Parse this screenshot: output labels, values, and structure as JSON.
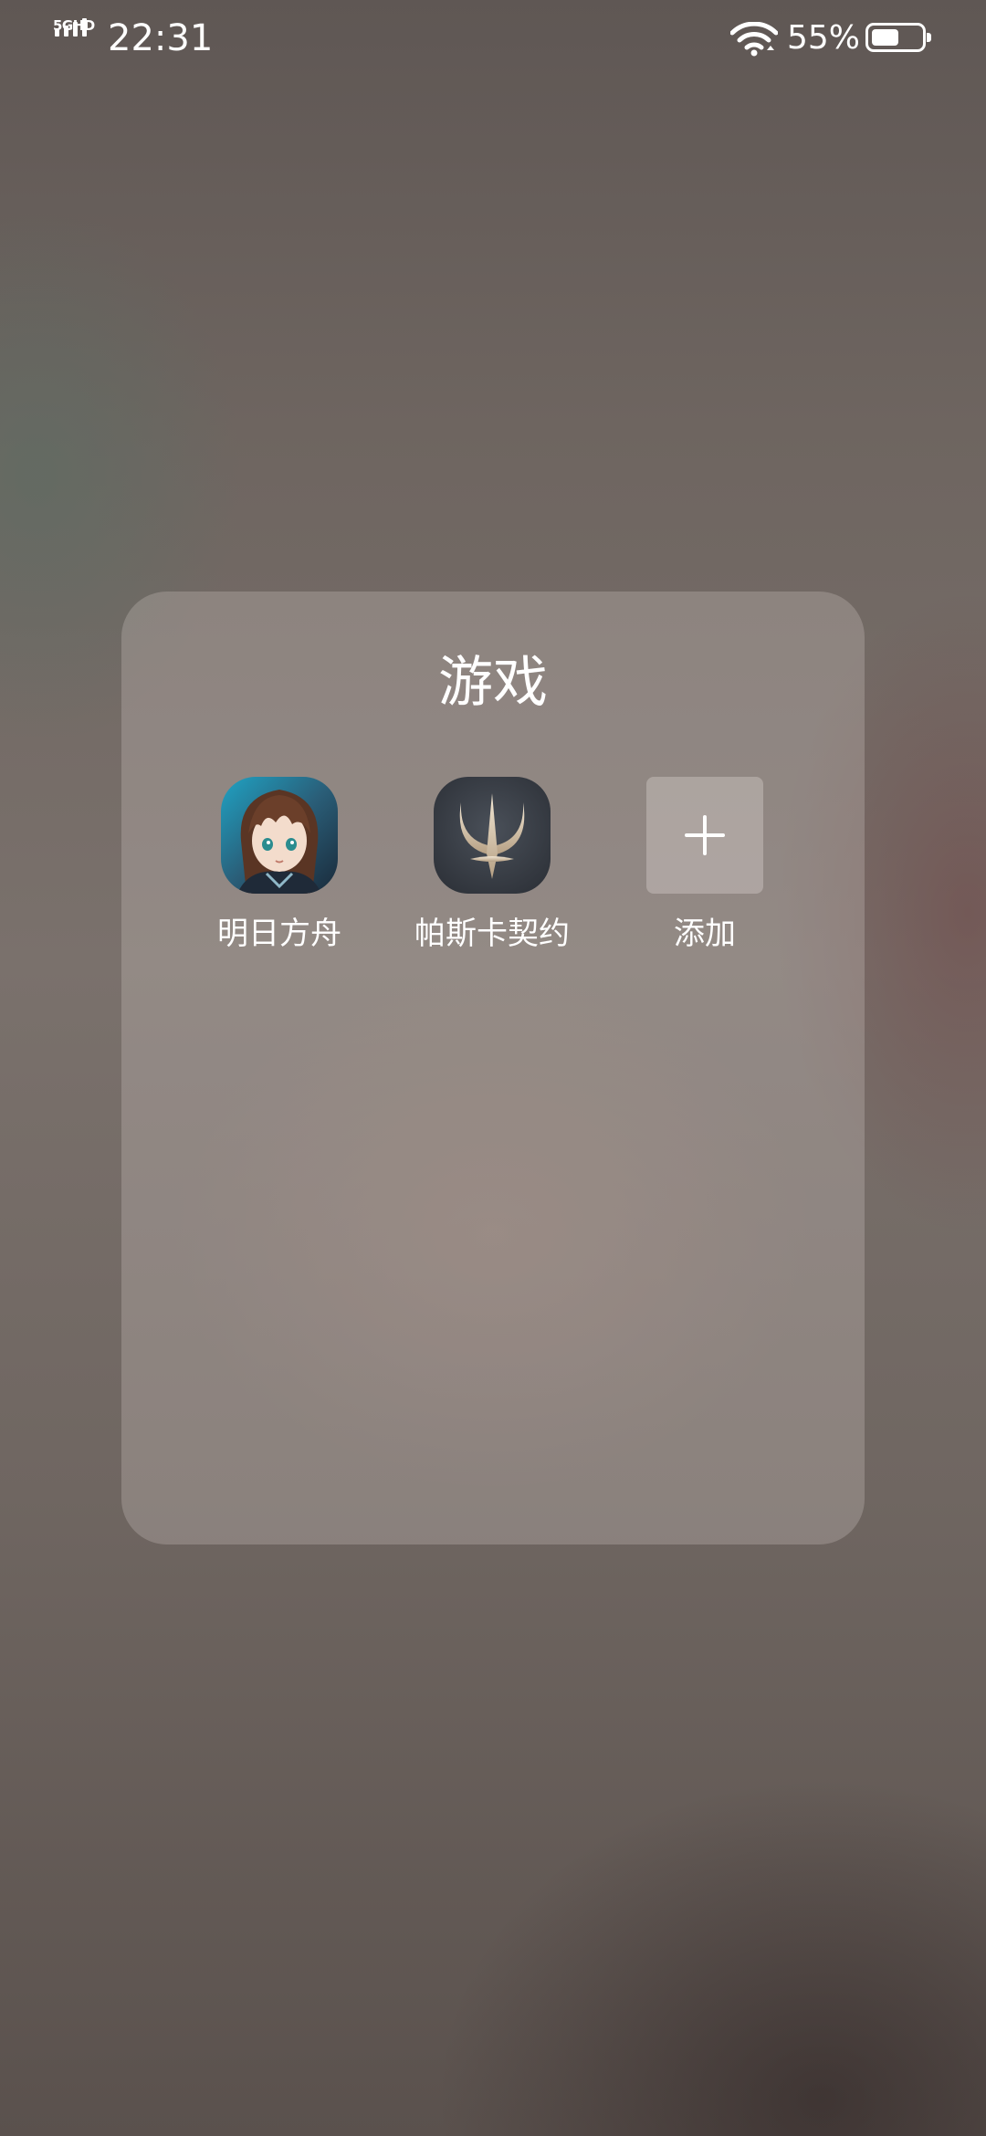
{
  "status_bar": {
    "network_type": "5GHD",
    "time": "22:31",
    "battery_percent": "55%",
    "battery_level": 0.55,
    "icons": [
      "signal-icon",
      "wifi-icon",
      "battery-icon"
    ]
  },
  "folder": {
    "title": "游戏",
    "apps": [
      {
        "label": "明日方舟",
        "icon": "arknights-app-icon"
      },
      {
        "label": "帕斯卡契约",
        "icon": "pascal-contract-app-icon"
      }
    ],
    "add_button": {
      "label": "添加",
      "icon": "plus-icon"
    }
  }
}
